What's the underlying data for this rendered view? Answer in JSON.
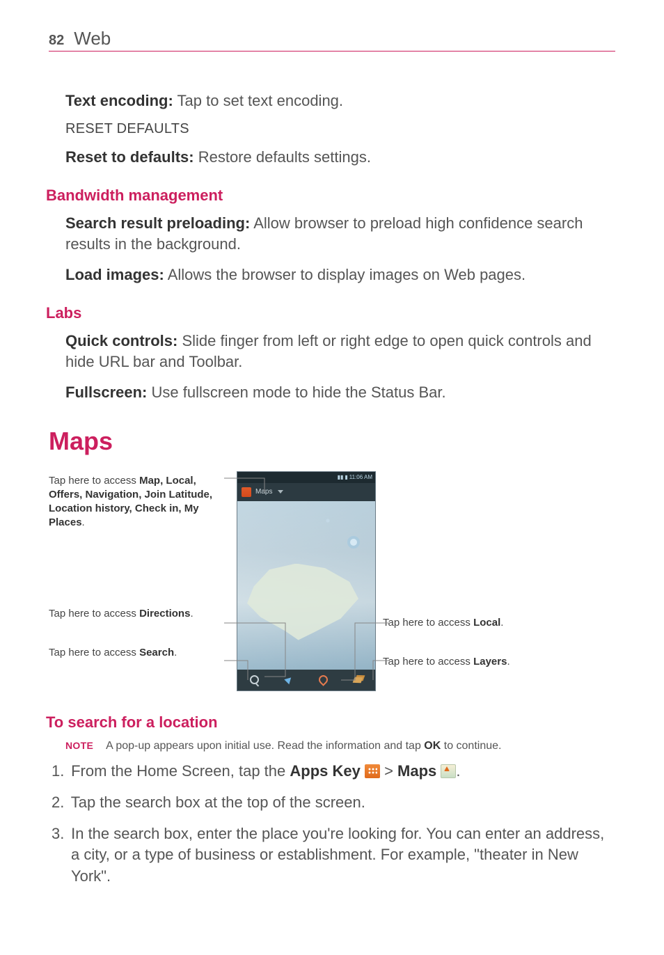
{
  "page_number": "82",
  "chapter": "Web",
  "text_encoding": {
    "label": "Text encoding:",
    "desc": " Tap to set text encoding."
  },
  "reset_defaults_header": "RESET DEFAULTS",
  "reset_defaults": {
    "label": "Reset to defaults:",
    "desc": " Restore defaults settings."
  },
  "bandwidth_header": "Bandwidth management",
  "search_preload": {
    "label": "Search result preloading:",
    "desc": " Allow browser to preload high confidence search results in the background."
  },
  "load_images": {
    "label": "Load images:",
    "desc": " Allows the browser to display images on Web pages."
  },
  "labs_header": "Labs",
  "quick_controls": {
    "label": "Quick controls:",
    "desc": " Slide finger from left or right edge to open quick controls and hide URL bar and Toolbar."
  },
  "fullscreen": {
    "label": "Fullscreen:",
    "desc": " Use fullscreen mode to hide the Status Bar."
  },
  "maps_header": "Maps",
  "callouts": {
    "menu_pre": "Tap here to access ",
    "menu_items": "Map, Local, Offers, Navigation, Join Latitude, Location history, Check in, My Places",
    "directions_pre": "Tap here to access ",
    "directions_bold": "Directions",
    "search_pre": "Tap here to access ",
    "search_bold": "Search",
    "local_pre": "Tap here to access ",
    "local_bold": "Local",
    "layers_pre": "Tap here to access ",
    "layers_bold": "Layers"
  },
  "phone": {
    "status_time": "11:06 AM",
    "appbar_title": "Maps"
  },
  "search_location_header": "To search for a location",
  "note": {
    "label": "NOTE",
    "pre": "A pop-up appears upon initial use. Read the information and tap ",
    "bold": "OK",
    "post": " to continue."
  },
  "steps": {
    "s1_num": "1.",
    "s1_a": "  From the Home Screen, tap the ",
    "s1_b": "Apps Key ",
    "s1_c": " > ",
    "s1_d": "Maps ",
    "s1_e": ".",
    "s2_num": "2.",
    "s2": "  Tap the search box at the top of the screen.",
    "s3_num": "3.",
    "s3": "  In the search box, enter the place you're looking for. You can enter an address, a city, or a type of business or establishment. For example, \"theater in New York\"."
  }
}
